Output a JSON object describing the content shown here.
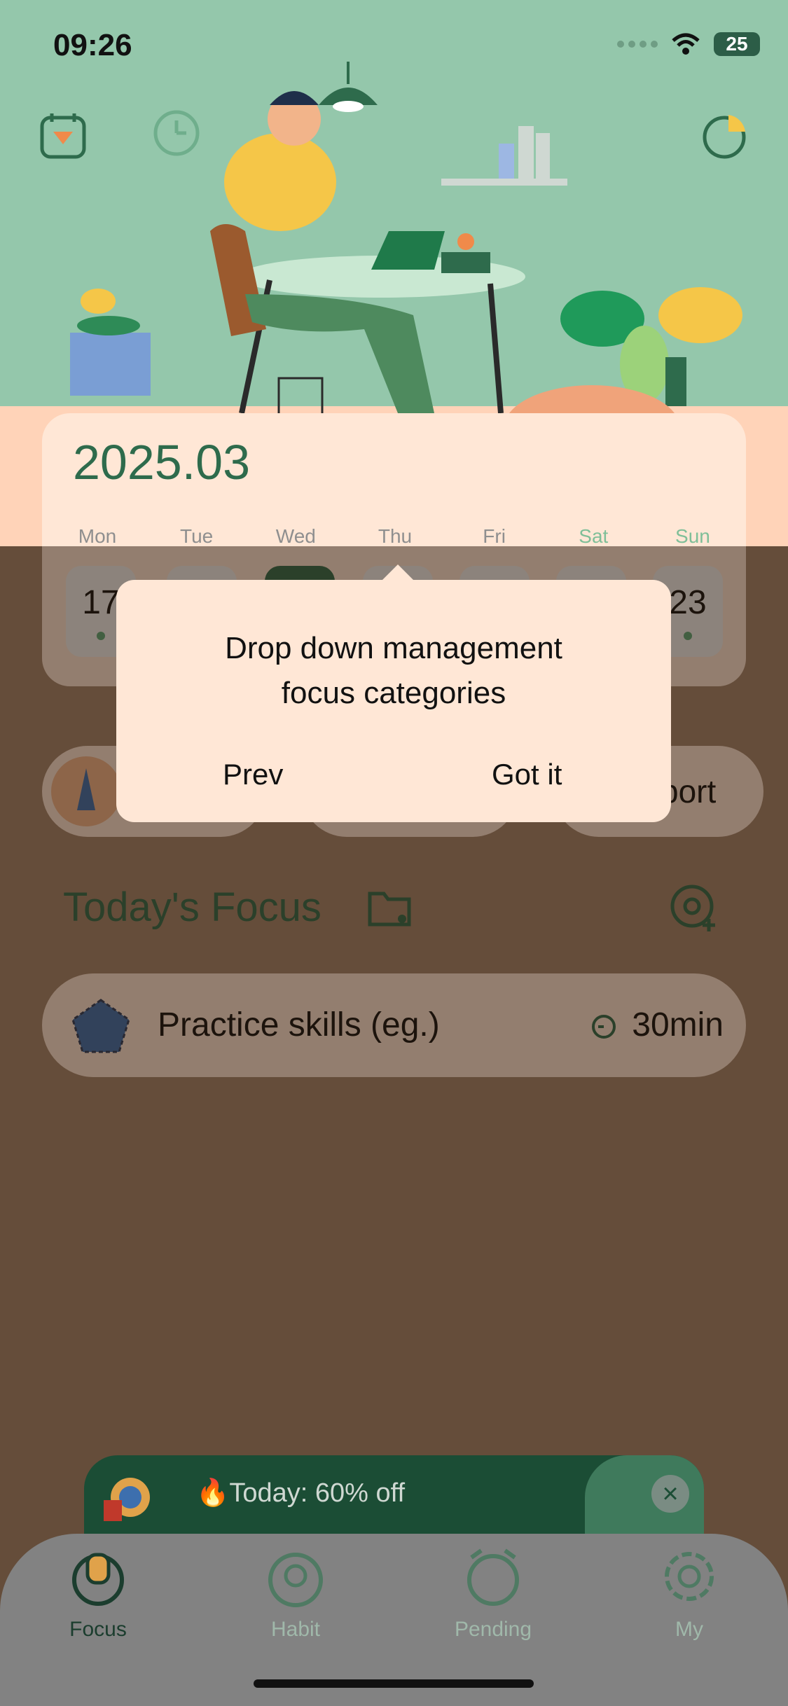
{
  "status_bar": {
    "time": "09:26",
    "battery": "25"
  },
  "header_icons": {
    "calendar": "calendar-icon",
    "clock": "clock-icon",
    "stats": "pie-chart-icon"
  },
  "calendar": {
    "month": "2025.03",
    "weekdays": [
      "Mon",
      "Tue",
      "Wed",
      "Thu",
      "Fri",
      "Sat",
      "Sun"
    ],
    "first_day": "17",
    "last_day": "23"
  },
  "categories": {
    "visible_label": "sport"
  },
  "focus": {
    "title": "Today's Focus",
    "item_name": "Practice skills (eg.)",
    "item_duration": "30min"
  },
  "promo": {
    "text": "🔥Today: 60% off"
  },
  "tabs": [
    {
      "label": "Focus",
      "icon": "focus-icon"
    },
    {
      "label": "Habit",
      "icon": "habit-icon"
    },
    {
      "label": "Pending",
      "icon": "pending-icon"
    },
    {
      "label": "My",
      "icon": "settings-icon"
    }
  ],
  "popup": {
    "message_line1": "Drop down management",
    "message_line2": "focus categories",
    "prev_label": "Prev",
    "got_label": "Got it"
  },
  "colors": {
    "brand_green": "#2e6b4c",
    "header_green": "#94c7ab",
    "peach": "#ffe7d6"
  }
}
